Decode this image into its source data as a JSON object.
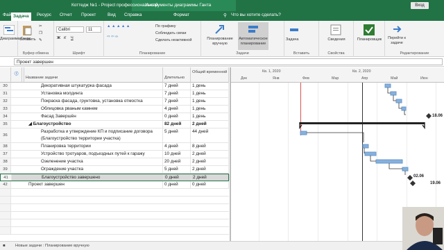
{
  "window": {
    "title": "Коттедж №1 - Project профессиональный",
    "context_tab": "Инструменты диаграммы Ганта",
    "signin": "Вход"
  },
  "tabs": [
    "Файл",
    "Задача",
    "Ресурс",
    "Отчет",
    "Проект",
    "Вид",
    "Справка",
    "Формат"
  ],
  "search_placeholder": "Что вы хотите сделать?",
  "ribbon": {
    "gantt_label": "Диаграмма Ганта",
    "paste": "Вставить",
    "clipboard": "Буфер обмена",
    "font_name": "Calibri",
    "font_size": "11",
    "font_group": "Шрифт",
    "on_schedule": "По графику",
    "respect_links": "Соблюдать связи",
    "make_inactive": "Сделать неактивной",
    "schedule_group": "Планирование",
    "manual": "Планирование вручную",
    "auto": "Автоматическое планирование",
    "tasks_group": "Задачи",
    "task": "Задача",
    "insert_group": "Вставить",
    "info": "Сведения",
    "props_group": "Свойства",
    "planner": "Планировщик",
    "goto": "Перейти к задаче",
    "edit_group": "Редактирование"
  },
  "entry_value": "Проект завершен",
  "columns": {
    "name": "Название задачи",
    "duration": "Длительно",
    "total_slack": "Общий временной"
  },
  "rows": [
    {
      "id": "30",
      "name": "Декоративная штукатурка фасада",
      "dur": "7 дней",
      "slack": "1 день",
      "indent": 1,
      "bold": false
    },
    {
      "id": "31",
      "name": "Установка молдинга",
      "dur": "7 дней",
      "slack": "1 день",
      "indent": 1,
      "bold": false
    },
    {
      "id": "32",
      "name": "Покраска фасада, грунтовка, установка отмостка",
      "dur": "7 дней",
      "slack": "1 день",
      "indent": 1,
      "bold": false
    },
    {
      "id": "33",
      "name": "Облицовка рваным камнем",
      "dur": "4 дней",
      "slack": "1 день",
      "indent": 1,
      "bold": false
    },
    {
      "id": "34",
      "name": "Фасад Завершён",
      "dur": "0 дней",
      "slack": "1 день",
      "indent": 1,
      "bold": false
    },
    {
      "id": "35",
      "name": "Благоустройство",
      "dur": "82 дней",
      "slack": "2 дней",
      "indent": 0,
      "bold": true
    },
    {
      "id": "36",
      "name": "Разработка и утверждение КП и подписание договора",
      "name2": "(Благоустройство территории участка)",
      "dur": "5 дней",
      "slack": "44 дней",
      "indent": 1,
      "bold": false
    },
    {
      "id": "38",
      "name": "Планировка территории",
      "dur": "4 дней",
      "slack": "8 дней",
      "indent": 1,
      "bold": false
    },
    {
      "id": "37",
      "name": "Устройство тротуаров, подъездных путей к гаражу",
      "dur": "10 дней",
      "slack": "2 дней",
      "indent": 1,
      "bold": false
    },
    {
      "id": "38",
      "name": "Озеленение участка",
      "dur": "20 дней",
      "slack": "2 дней",
      "indent": 1,
      "bold": false
    },
    {
      "id": "39",
      "name": "Ограждение участка",
      "dur": "5 дней",
      "slack": "2 дней",
      "indent": 1,
      "bold": false
    },
    {
      "id": "41",
      "name": "Благоустройство завершено",
      "dur": "0 дней",
      "slack": "2 дней",
      "indent": 1,
      "bold": false
    },
    {
      "id": "42",
      "name": "Проект завершен",
      "dur": "0 дней",
      "slack": "0 дней",
      "indent": 0,
      "bold": false
    }
  ],
  "gantt": {
    "quarters": [
      "Кв. 1, 2020",
      "Кв. 2, 2020"
    ],
    "months": [
      "Дек",
      "Янв",
      "Фев",
      "Мар",
      "Апр",
      "Май",
      "Июн"
    ],
    "labels": [
      "18.06",
      "02.06",
      "19.06"
    ]
  },
  "status": {
    "new_tasks": "Новые задачи : Планирование вручную"
  }
}
